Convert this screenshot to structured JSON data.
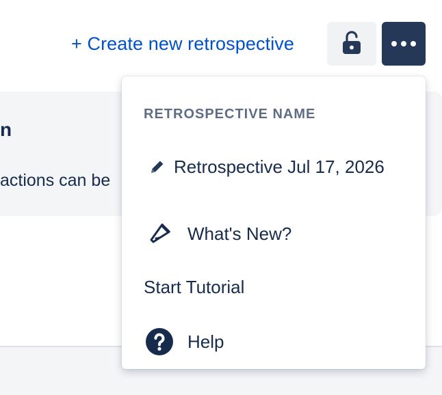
{
  "header": {
    "create_link": "+ Create new retrospective",
    "lock_icon": "unlocked-padlock-icon",
    "more_icon": "more-horizontal-icon"
  },
  "background": {
    "heading_fragment": "n",
    "text_fragment": "actions can be"
  },
  "menu": {
    "section_title": "RETROSPECTIVE NAME",
    "items": [
      {
        "label": "Retrospective Jul 17, 2026",
        "icon": "pencil-icon"
      },
      {
        "label": "What's New?",
        "icon": "megaphone-icon"
      },
      {
        "label": "Start Tutorial"
      },
      {
        "label": "Help",
        "icon": "question-circle-icon"
      }
    ]
  },
  "colors": {
    "link": "#0052cc",
    "primary_dark": "#253858",
    "text": "#172b4d",
    "subtle_text": "#5e6c84",
    "surface": "#f4f5f7"
  }
}
